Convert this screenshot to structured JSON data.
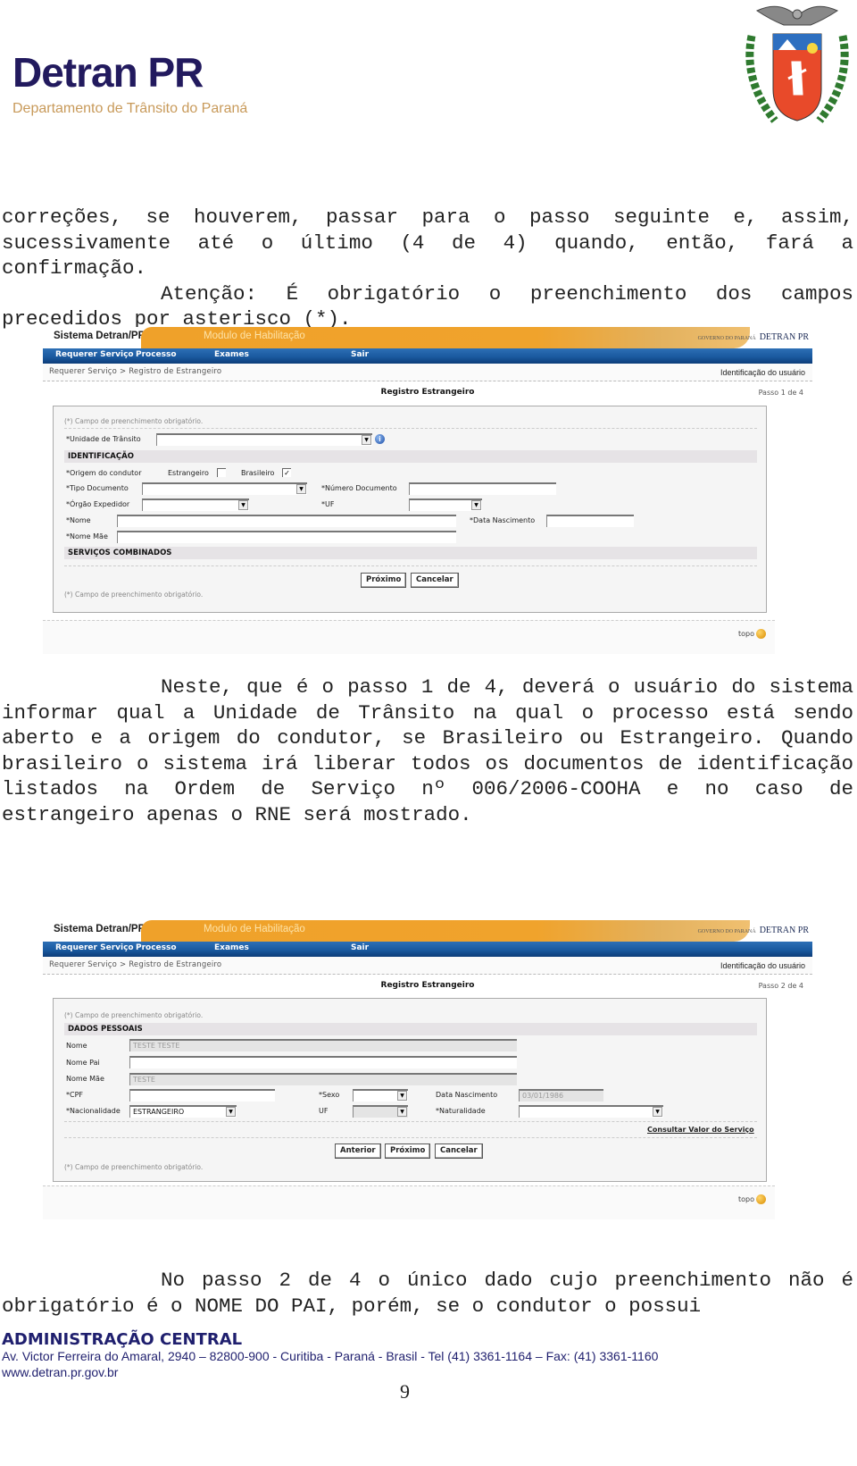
{
  "header": {
    "logo_title": "Detran PR",
    "logo_subtitle": "Departamento de Trânsito do Paraná",
    "coat_of_arms": "parana-coat-of-arms-icon"
  },
  "paragraphs": {
    "p1": "correções, se houverem, passar para o passo seguinte e, assim, sucessivamente até o último (4 de 4) quando, então, fará a confirmação.",
    "p2": "Atenção: É obrigatório o preenchimento dos campos precedidos por asterisco (*).",
    "p3": "Neste, que é o passo 1 de 4, deverá o usuário do sistema informar qual a Unidade de Trânsito na qual o processo está sendo aberto e a origem do condutor, se Brasileiro ou Estrangeiro. Quando brasileiro o sistema irá liberar todos os documentos de identificação listados na Ordem de Serviço nº 006/2006-COOHA e no caso de estrangeiro apenas o RNE será mostrado.",
    "p4": "No passo 2 de 4 o único dado cujo preenchimento não é obrigatório é o NOME DO PAI, porém, se o condutor o possui"
  },
  "app": {
    "system_name": "Sistema Detran/PR",
    "module_name": "Modulo de Habilitação",
    "gov_small": "GOVERNO DO PARANÁ",
    "gov_brand": "DETRAN PR",
    "nav": [
      "Requerer Serviço",
      "Processo",
      "Exames",
      "Sair"
    ],
    "breadcrumb": "Requerer Serviço > Registro de Estrangeiro",
    "user_id_label": "Identificação do usuário",
    "form_title": "Registro Estrangeiro",
    "required_note": "(*) Campo de preenchimento obrigatório.",
    "top_link": "topo"
  },
  "step1": {
    "step_label": "Passo 1 de 4",
    "unidade_label": "*Unidade de Trânsito",
    "unidade_value": "",
    "section_identificacao": "IDENTIFICAÇÃO",
    "origem_label": "*Origem do condutor",
    "estrangeiro_label": "Estrangeiro",
    "estrangeiro_checked": false,
    "brasileiro_label": "Brasileiro",
    "brasileiro_checked": true,
    "check_glyph": "✓",
    "tipo_doc_label": "*Tipo Documento",
    "tipo_doc_value": "",
    "numero_doc_label": "*Número Documento",
    "numero_doc_value": "",
    "orgao_label": "*Órgão Expedidor",
    "orgao_value": "",
    "uf_label": "*UF",
    "uf_value": "",
    "nome_label": "*Nome",
    "nome_value": "",
    "data_nasc_label": "*Data Nascimento",
    "data_nasc_value": "",
    "nome_mae_label": "*Nome Mãe",
    "nome_mae_value": "",
    "section_servicos": "SERVIÇOS COMBINADOS",
    "btn_proximo": "Próximo",
    "btn_cancelar": "Cancelar"
  },
  "step2": {
    "step_label": "Passo 2 de 4",
    "section_dados": "DADOS PESSOAIS",
    "nome_label": "Nome",
    "nome_value": "TESTE TESTE",
    "nome_pai_label": "Nome Pai",
    "nome_pai_value": "",
    "nome_mae_label": "Nome Mãe",
    "nome_mae_value": "TESTE",
    "cpf_label": "*CPF",
    "cpf_value": "",
    "sexo_label": "*Sexo",
    "sexo_value": "",
    "data_nasc_label": "Data Nascimento",
    "data_nasc_value": "03/01/1986",
    "nacionalidade_label": "*Nacionalidade",
    "nacionalidade_value": "ESTRANGEIRO",
    "uf_label": "UF",
    "uf_value": "",
    "naturalidade_label": "*Naturalidade",
    "naturalidade_value": "",
    "consultar_link": "Consultar Valor do Serviço",
    "btn_anterior": "Anterior",
    "btn_proximo": "Próximo",
    "btn_cancelar": "Cancelar"
  },
  "footer": {
    "org": "ADMINISTRAÇÃO CENTRAL",
    "address": "Av. Victor Ferreira do Amaral, 2940 – 82800-900 - Curitiba - Paraná - Brasil - Tel (41) 3361-1164 – Fax: (41) 3361-1160",
    "website": "www.detran.pr.gov.br",
    "page_number": "9"
  }
}
